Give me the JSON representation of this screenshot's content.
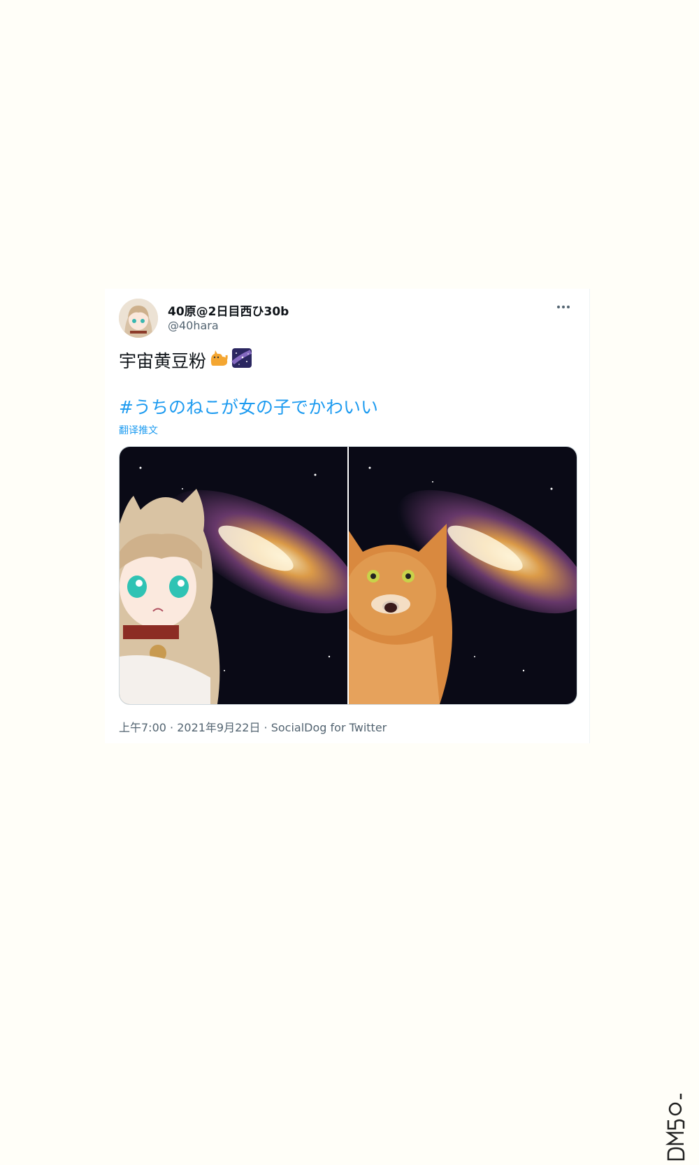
{
  "user": {
    "display_name": "40原@2日目西ひ30b",
    "handle": "@40hara"
  },
  "tweet": {
    "text": "宇宙黄豆粉",
    "emojis": [
      "cat-emoji",
      "milky-way-emoji"
    ],
    "hashtag": "#うちのねこが女の子でかわいい",
    "translate_label": "翻译推文"
  },
  "meta": {
    "time": "上午7:00",
    "date": "2021年9月22日",
    "source": "SocialDog for Twitter",
    "separator": " · "
  },
  "colors": {
    "link": "#1d9bf0",
    "text": "#0f1419",
    "secondary": "#536471",
    "background": "#fffef8"
  }
}
